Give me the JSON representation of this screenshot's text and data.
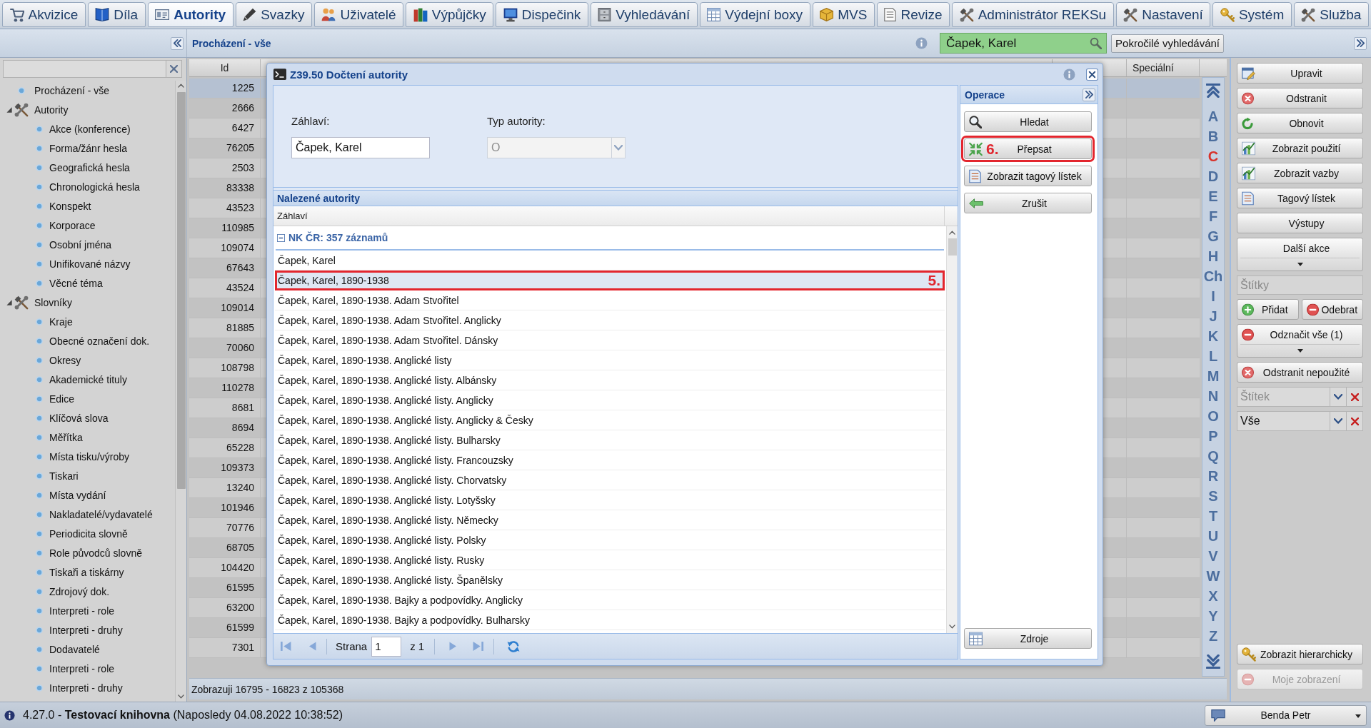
{
  "tabs": [
    {
      "label": "Akvizice",
      "selected": false
    },
    {
      "label": "Díla",
      "selected": false
    },
    {
      "label": "Autority",
      "selected": true
    },
    {
      "label": "Svazky",
      "selected": false
    },
    {
      "label": "Uživatelé",
      "selected": false
    },
    {
      "label": "Výpůjčky",
      "selected": false
    },
    {
      "label": "Dispečink",
      "selected": false
    },
    {
      "label": "Vyhledávání",
      "selected": false
    },
    {
      "label": "Výdejní boxy",
      "selected": false
    },
    {
      "label": "MVS",
      "selected": false
    },
    {
      "label": "Revize",
      "selected": false
    },
    {
      "label": "Administrátor REKSu",
      "selected": false
    },
    {
      "label": "Nastavení",
      "selected": false
    },
    {
      "label": "Systém",
      "selected": false
    },
    {
      "label": "Služba",
      "selected": false
    }
  ],
  "toolbar": {
    "title": "Procházení - vše",
    "search": {
      "value": "Čapek, Karel"
    },
    "advanced_search_button": "Pokročilé vyhledávání"
  },
  "sidebar": {
    "tree": [
      {
        "label": "Procházení - vše",
        "kind": "leaf"
      },
      {
        "label": "Autority",
        "kind": "folder",
        "expanded": true,
        "children": [
          {
            "label": "Akce (konference)"
          },
          {
            "label": "Forma/žánr hesla"
          },
          {
            "label": "Geografická hesla"
          },
          {
            "label": "Chronologická hesla"
          },
          {
            "label": "Konspekt"
          },
          {
            "label": "Korporace"
          },
          {
            "label": "Osobní jména"
          },
          {
            "label": "Unifikované názvy"
          },
          {
            "label": "Věcné téma"
          }
        ]
      },
      {
        "label": "Slovníky",
        "kind": "folder",
        "expanded": true,
        "children": [
          {
            "label": "Kraje"
          },
          {
            "label": "Obecné označení dok."
          },
          {
            "label": "Okresy"
          },
          {
            "label": "Akademické tituly"
          },
          {
            "label": "Edice"
          },
          {
            "label": "Klíčová slova"
          },
          {
            "label": "Měřítka"
          },
          {
            "label": "Místa tisku/výroby"
          },
          {
            "label": "Tiskari"
          },
          {
            "label": "Místa vydání"
          },
          {
            "label": "Nakladatelé/vydavatelé"
          },
          {
            "label": "Periodicita slovně"
          },
          {
            "label": "Role původců slovně"
          },
          {
            "label": "Tiskaři a tiskárny"
          },
          {
            "label": "Zdrojový dok."
          },
          {
            "label": "Interpreti - role"
          },
          {
            "label": "Interpreti - druhy"
          },
          {
            "label": "Dodavatelé"
          },
          {
            "label": "Interpreti - role"
          },
          {
            "label": "Interpreti - druhy"
          }
        ]
      }
    ]
  },
  "grid": {
    "columns": [
      {
        "label": "Id"
      },
      {
        "label": "Speciální"
      }
    ],
    "rows": [
      {
        "id": "1225",
        "selected": true
      },
      {
        "id": "2666",
        "selected": false
      },
      {
        "id": "6427",
        "selected": false
      },
      {
        "id": "76205",
        "selected": false
      },
      {
        "id": "2503",
        "selected": false
      },
      {
        "id": "83338",
        "selected": false
      },
      {
        "id": "43523",
        "selected": false
      },
      {
        "id": "110985",
        "selected": false
      },
      {
        "id": "109074",
        "selected": false
      },
      {
        "id": "67643",
        "selected": false
      },
      {
        "id": "43524",
        "selected": false
      },
      {
        "id": "109014",
        "selected": false
      },
      {
        "id": "81885",
        "selected": false
      },
      {
        "id": "70060",
        "selected": false
      },
      {
        "id": "108798",
        "selected": false
      },
      {
        "id": "110278",
        "selected": false
      },
      {
        "id": "8681",
        "selected": false
      },
      {
        "id": "8694",
        "selected": false
      },
      {
        "id": "65228",
        "selected": false
      },
      {
        "id": "109373",
        "selected": false
      },
      {
        "id": "13240",
        "selected": false
      },
      {
        "id": "101946",
        "selected": false
      },
      {
        "id": "70776",
        "selected": false
      },
      {
        "id": "68705",
        "selected": false
      },
      {
        "id": "104420",
        "selected": false
      },
      {
        "id": "61595",
        "selected": false
      },
      {
        "id": "63200",
        "selected": false
      },
      {
        "id": "61599",
        "selected": false
      },
      {
        "id": "7301",
        "selected": false
      }
    ],
    "footer": "Zobrazuji 16795 - 16823 z 105368"
  },
  "alphabet": {
    "letters": [
      {
        "label": "A",
        "selected": false
      },
      {
        "label": "B",
        "selected": false
      },
      {
        "label": "C",
        "selected": true
      },
      {
        "label": "D",
        "selected": false
      },
      {
        "label": "E",
        "selected": false
      },
      {
        "label": "F",
        "selected": false
      },
      {
        "label": "G",
        "selected": false
      },
      {
        "label": "H",
        "selected": false
      },
      {
        "label": "Ch",
        "selected": false
      },
      {
        "label": "I",
        "selected": false
      },
      {
        "label": "J",
        "selected": false
      },
      {
        "label": "K",
        "selected": false
      },
      {
        "label": "L",
        "selected": false
      },
      {
        "label": "M",
        "selected": false
      },
      {
        "label": "N",
        "selected": false
      },
      {
        "label": "O",
        "selected": false
      },
      {
        "label": "P",
        "selected": false
      },
      {
        "label": "Q",
        "selected": false
      },
      {
        "label": "R",
        "selected": false
      },
      {
        "label": "S",
        "selected": false
      },
      {
        "label": "T",
        "selected": false
      },
      {
        "label": "U",
        "selected": false
      },
      {
        "label": "V",
        "selected": false
      },
      {
        "label": "W",
        "selected": false
      },
      {
        "label": "X",
        "selected": false
      },
      {
        "label": "Y",
        "selected": false
      },
      {
        "label": "Z",
        "selected": false
      }
    ]
  },
  "dialog": {
    "title": "Z39.50 Dočtení autority",
    "form": {
      "fields": [
        {
          "label": "Záhlaví:",
          "value": "Čapek, Karel",
          "kind": "text",
          "disabled": false
        },
        {
          "label": "Typ autority:",
          "value": "O",
          "kind": "select",
          "disabled": true
        }
      ]
    },
    "results": {
      "title": "Nalezené autority",
      "column": "Záhlaví",
      "groups": [
        {
          "label": "NK ČR: 357 záznamů",
          "expanded": true,
          "rows": [
            {
              "label": "Čapek, Karel",
              "selected": false
            },
            {
              "label": "Čapek, Karel, 1890-1938",
              "selected": true,
              "annotation": "5."
            },
            {
              "label": "Čapek, Karel, 1890-1938. Adam Stvořitel",
              "selected": false
            },
            {
              "label": "Čapek, Karel, 1890-1938. Adam Stvořitel. Anglicky",
              "selected": false
            },
            {
              "label": "Čapek, Karel, 1890-1938. Adam Stvořitel. Dánsky",
              "selected": false
            },
            {
              "label": "Čapek, Karel, 1890-1938. Anglické listy",
              "selected": false
            },
            {
              "label": "Čapek, Karel, 1890-1938. Anglické listy. Albánsky",
              "selected": false
            },
            {
              "label": "Čapek, Karel, 1890-1938. Anglické listy. Anglicky",
              "selected": false
            },
            {
              "label": "Čapek, Karel, 1890-1938. Anglické listy. Anglicky & Česky",
              "selected": false
            },
            {
              "label": "Čapek, Karel, 1890-1938. Anglické listy. Bulharsky",
              "selected": false
            },
            {
              "label": "Čapek, Karel, 1890-1938. Anglické listy. Francouzsky",
              "selected": false
            },
            {
              "label": "Čapek, Karel, 1890-1938. Anglické listy. Chorvatsky",
              "selected": false
            },
            {
              "label": "Čapek, Karel, 1890-1938. Anglické listy. Lotyšsky",
              "selected": false
            },
            {
              "label": "Čapek, Karel, 1890-1938. Anglické listy. Německy",
              "selected": false
            },
            {
              "label": "Čapek, Karel, 1890-1938. Anglické listy. Polsky",
              "selected": false
            },
            {
              "label": "Čapek, Karel, 1890-1938. Anglické listy. Rusky",
              "selected": false
            },
            {
              "label": "Čapek, Karel, 1890-1938. Anglické listy. Španělsky",
              "selected": false
            },
            {
              "label": "Čapek, Karel, 1890-1938. Bajky a podpovídky. Anglicky",
              "selected": false
            },
            {
              "label": "Čapek, Karel, 1890-1938. Bajky a podpovídky. Bulharsky",
              "selected": false
            }
          ]
        }
      ]
    },
    "pager": {
      "label": "Strana",
      "page": "1",
      "total": "z 1"
    },
    "operations": {
      "title": "Operace",
      "buttons": [
        {
          "label": "Hledat"
        },
        {
          "label": "Přepsat",
          "annotation": "6."
        },
        {
          "label": "Zobrazit tagový lístek"
        },
        {
          "label": "Zrušit"
        }
      ],
      "footer_button": "Zdroje"
    }
  },
  "right_panel": {
    "actions": [
      {
        "label": "Upravit",
        "kind": "button"
      },
      {
        "label": "Odstranit",
        "kind": "button"
      },
      {
        "label": "Obnovit",
        "kind": "button"
      },
      {
        "label": "Zobrazit použití",
        "kind": "button"
      },
      {
        "label": "Zobrazit vazby",
        "kind": "button"
      },
      {
        "label": "Tagový lístek",
        "kind": "button"
      },
      {
        "label": "Výstupy",
        "kind": "button"
      },
      {
        "label": "Další akce",
        "kind": "menu"
      }
    ],
    "tags_field": {
      "placeholder": "Štítky"
    },
    "tag_buttons": [
      {
        "label": "Přidat"
      },
      {
        "label": "Odebrat"
      }
    ],
    "tag_actions": [
      {
        "label": "Odznačit vše (1)",
        "kind": "menu"
      },
      {
        "label": "Odstranit nepoužité",
        "kind": "button"
      }
    ],
    "filters": [
      {
        "placeholder": "Štítek"
      },
      {
        "value": "Vše"
      }
    ],
    "bottom_actions": [
      {
        "label": "Zobrazit hierarchicky",
        "disabled": false
      },
      {
        "label": "Moje zobrazení",
        "disabled": true
      }
    ]
  },
  "status_bar": {
    "text": "4.27.0 - **Testovací knihovna** (Naposledy 04.08.2022 10:38:52)",
    "user": "Benda Petr"
  }
}
